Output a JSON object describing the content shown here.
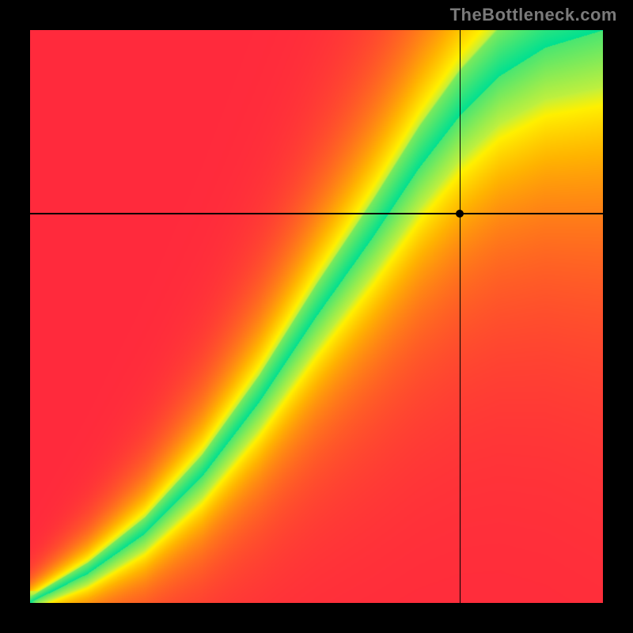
{
  "watermark": "TheBottleneck.com",
  "chart_data": {
    "type": "heatmap",
    "title": "",
    "xlabel": "",
    "ylabel": "",
    "xlim": [
      0,
      100
    ],
    "ylim": [
      0,
      100
    ],
    "marker": {
      "x": 75,
      "y": 68
    },
    "crosshair": {
      "x": 75,
      "y": 68
    },
    "color_scale": [
      {
        "score": 0.0,
        "color": "#ff2a3c"
      },
      {
        "score": 0.55,
        "color": "#ffb400"
      },
      {
        "score": 0.8,
        "color": "#fff000"
      },
      {
        "score": 0.92,
        "color": "#c3f03c"
      },
      {
        "score": 1.0,
        "color": "#00e091"
      }
    ],
    "optimal_curve": [
      {
        "x": 0,
        "y": 0
      },
      {
        "x": 10,
        "y": 5
      },
      {
        "x": 20,
        "y": 12
      },
      {
        "x": 30,
        "y": 22
      },
      {
        "x": 40,
        "y": 35
      },
      {
        "x": 50,
        "y": 50
      },
      {
        "x": 60,
        "y": 64
      },
      {
        "x": 68,
        "y": 76
      },
      {
        "x": 75,
        "y": 85
      },
      {
        "x": 82,
        "y": 92
      },
      {
        "x": 90,
        "y": 97
      },
      {
        "x": 100,
        "y": 100
      }
    ],
    "grid": false,
    "legend": false,
    "description": "2D bottleneck heatmap. Green diagonal curve = balanced region; red = severe bottleneck. Black crosshair marks the evaluated configuration."
  }
}
